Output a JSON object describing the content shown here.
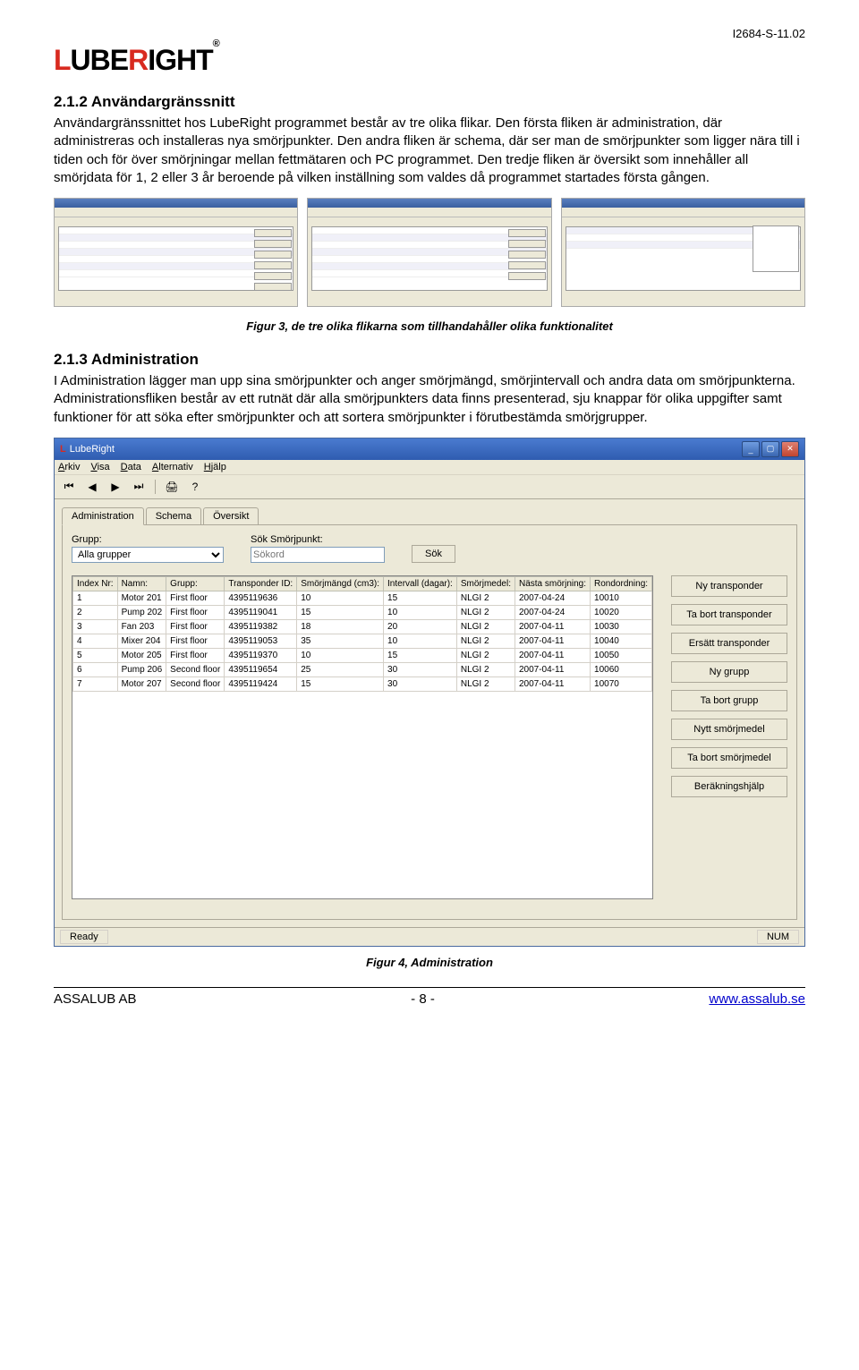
{
  "doc_id": "I2684-S-11.02",
  "logo_parts": {
    "l": "L",
    "ube": "UBE",
    "r": "R",
    "ight": "IGHT",
    "reg": "®"
  },
  "section1_heading": "2.1.2  Användargränssnitt",
  "section1_body": "Användargränssnittet hos LubeRight programmet består av tre olika flikar. Den första fliken är administration, där administreras och installeras nya smörjpunkter. Den andra fliken är schema, där ser man de smörjpunkter som ligger nära till i tiden och för över smörjningar mellan fettmätaren och PC programmet. Den tredje fliken är översikt som innehåller all smörjdata för 1, 2 eller 3 år beroende på vilken inställning som valdes då programmet startades första gången.",
  "figure3_caption": "Figur 3, de tre olika flikarna som tillhandahåller olika funktionalitet",
  "section2_heading": "2.1.3  Administration",
  "section2_body": "I Administration lägger man upp sina smörjpunkter och anger smörjmängd, smörjintervall och andra data om smörjpunkterna. Administrationsfliken består av ett rutnät där alla smörjpunkters data finns presenterad, sju knappar för olika uppgifter samt funktioner för att söka efter smörjpunkter och att sortera smörjpunkter i förutbestämda smörjgrupper.",
  "app": {
    "title": "LubeRight",
    "menu": [
      "Arkiv",
      "Visa",
      "Data",
      "Alternativ",
      "Hjälp"
    ],
    "toolbar_icons": [
      "⏮",
      "◀",
      "▶",
      "⏭",
      "🖨",
      "?"
    ],
    "tabs": [
      "Administration",
      "Schema",
      "Översikt"
    ],
    "group_label": "Grupp:",
    "group_value": "Alla grupper",
    "search_label": "Sök Smörjpunkt:",
    "search_placeholder": "Sökord",
    "search_button": "Sök",
    "columns": [
      "Index Nr:",
      "Namn:",
      "Grupp:",
      "Transponder ID:",
      "Smörjmängd (cm3):",
      "Intervall (dagar):",
      "Smörjmedel:",
      "Nästa smörjning:",
      "Rondordning:"
    ],
    "rows": [
      [
        "1",
        "Motor 201",
        "First floor",
        "4395119636",
        "10",
        "15",
        "NLGI 2",
        "2007-04-24",
        "10010"
      ],
      [
        "2",
        "Pump 202",
        "First floor",
        "4395119041",
        "15",
        "10",
        "NLGI 2",
        "2007-04-24",
        "10020"
      ],
      [
        "3",
        "Fan 203",
        "First floor",
        "4395119382",
        "18",
        "20",
        "NLGI 2",
        "2007-04-11",
        "10030"
      ],
      [
        "4",
        "Mixer 204",
        "First floor",
        "4395119053",
        "35",
        "10",
        "NLGI 2",
        "2007-04-11",
        "10040"
      ],
      [
        "5",
        "Motor 205",
        "First floor",
        "4395119370",
        "10",
        "15",
        "NLGI 2",
        "2007-04-11",
        "10050"
      ],
      [
        "6",
        "Pump 206",
        "Second floor",
        "4395119654",
        "25",
        "30",
        "NLGI 2",
        "2007-04-11",
        "10060"
      ],
      [
        "7",
        "Motor 207",
        "Second floor",
        "4395119424",
        "15",
        "30",
        "NLGI 2",
        "2007-04-11",
        "10070"
      ]
    ],
    "side_buttons": [
      "Ny transponder",
      "Ta bort transponder",
      "Ersätt transponder",
      "Ny grupp",
      "Ta bort grupp",
      "Nytt smörjmedel",
      "Ta bort smörjmedel",
      "Beräkningshjälp"
    ],
    "status_left": "Ready",
    "status_right": "NUM"
  },
  "figure4_caption": "Figur 4, Administration",
  "footer": {
    "left": "ASSALUB AB",
    "center": "- 8 -",
    "right": "www.assalub.se"
  }
}
